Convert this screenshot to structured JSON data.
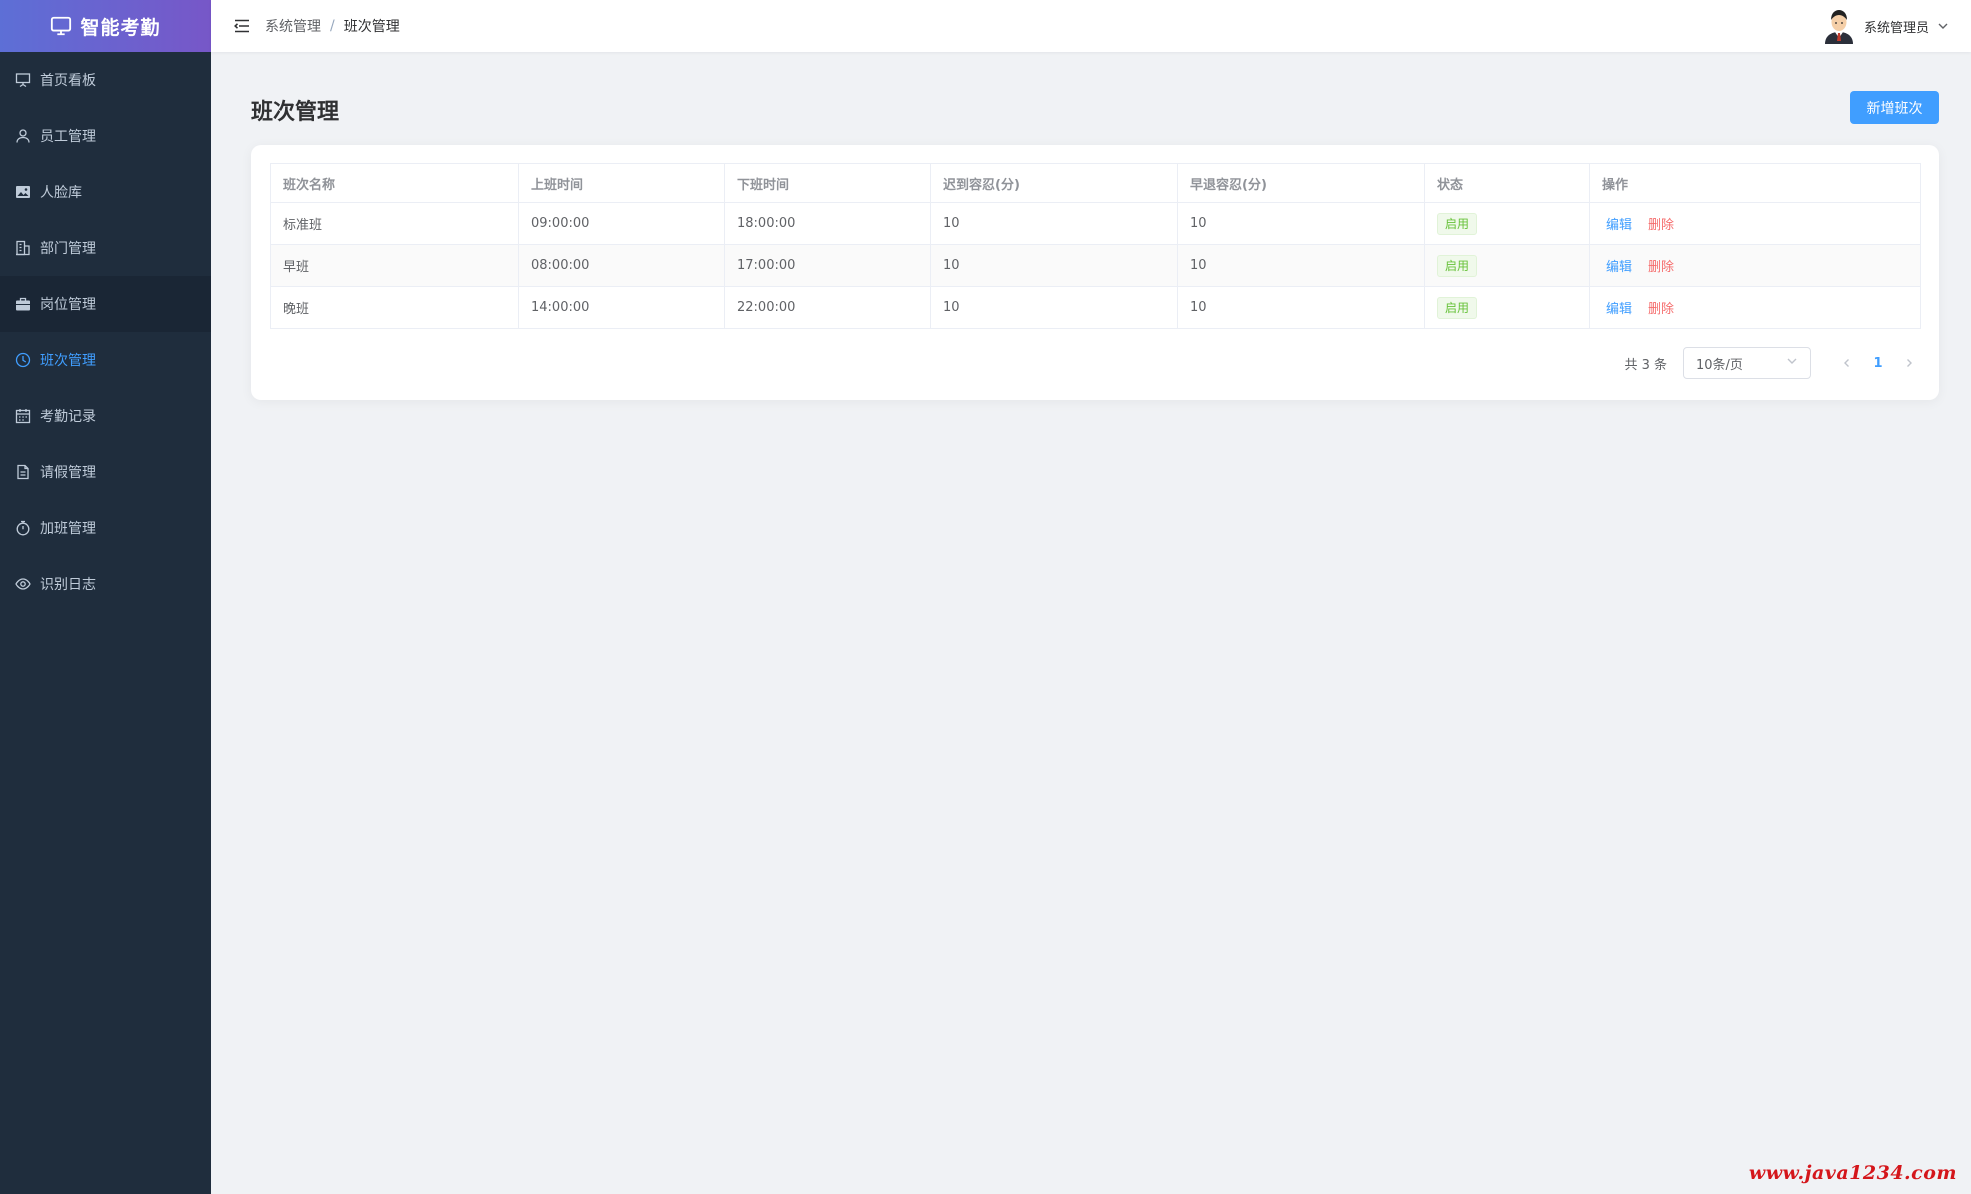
{
  "app": {
    "title": "智能考勤"
  },
  "sidebar": {
    "items": [
      {
        "label": "首页看板",
        "icon": "presentation-board-icon"
      },
      {
        "label": "员工管理",
        "icon": "user-icon"
      },
      {
        "label": "人脸库",
        "icon": "picture-icon"
      },
      {
        "label": "部门管理",
        "icon": "office-building-icon"
      },
      {
        "label": "岗位管理",
        "icon": "briefcase-icon"
      },
      {
        "label": "班次管理",
        "icon": "clock-icon"
      },
      {
        "label": "考勤记录",
        "icon": "calendar-icon"
      },
      {
        "label": "请假管理",
        "icon": "document-icon"
      },
      {
        "label": "加班管理",
        "icon": "stopwatch-icon"
      },
      {
        "label": "识别日志",
        "icon": "eye-icon"
      }
    ],
    "active_index": 5,
    "hover_index": 4
  },
  "header": {
    "breadcrumb": [
      "系统管理",
      "班次管理"
    ],
    "breadcrumb_sep": "/",
    "user_name": "系统管理员"
  },
  "main": {
    "title": "班次管理",
    "add_label": "新增班次"
  },
  "table": {
    "columns": [
      "班次名称",
      "上班时间",
      "下班时间",
      "迟到容忍(分)",
      "早退容忍(分)",
      "状态",
      "操作"
    ],
    "rows": [
      {
        "name": "标准班",
        "start": "09:00:00",
        "end": "18:00:00",
        "late": "10",
        "early": "10",
        "status": "启用"
      },
      {
        "name": "早班",
        "start": "08:00:00",
        "end": "17:00:00",
        "late": "10",
        "early": "10",
        "status": "启用"
      },
      {
        "name": "晚班",
        "start": "14:00:00",
        "end": "22:00:00",
        "late": "10",
        "early": "10",
        "status": "启用"
      }
    ],
    "edit_label": "编辑",
    "delete_label": "删除"
  },
  "pagination": {
    "total_text": "共 3 条",
    "page_size": "10条/页",
    "current_page": "1"
  },
  "watermark": "www.java1234.com",
  "colors": {
    "sidebar_bg": "#1f2d3d",
    "accent": "#409eff",
    "danger": "#f56c6c",
    "success": "#67c23a"
  }
}
